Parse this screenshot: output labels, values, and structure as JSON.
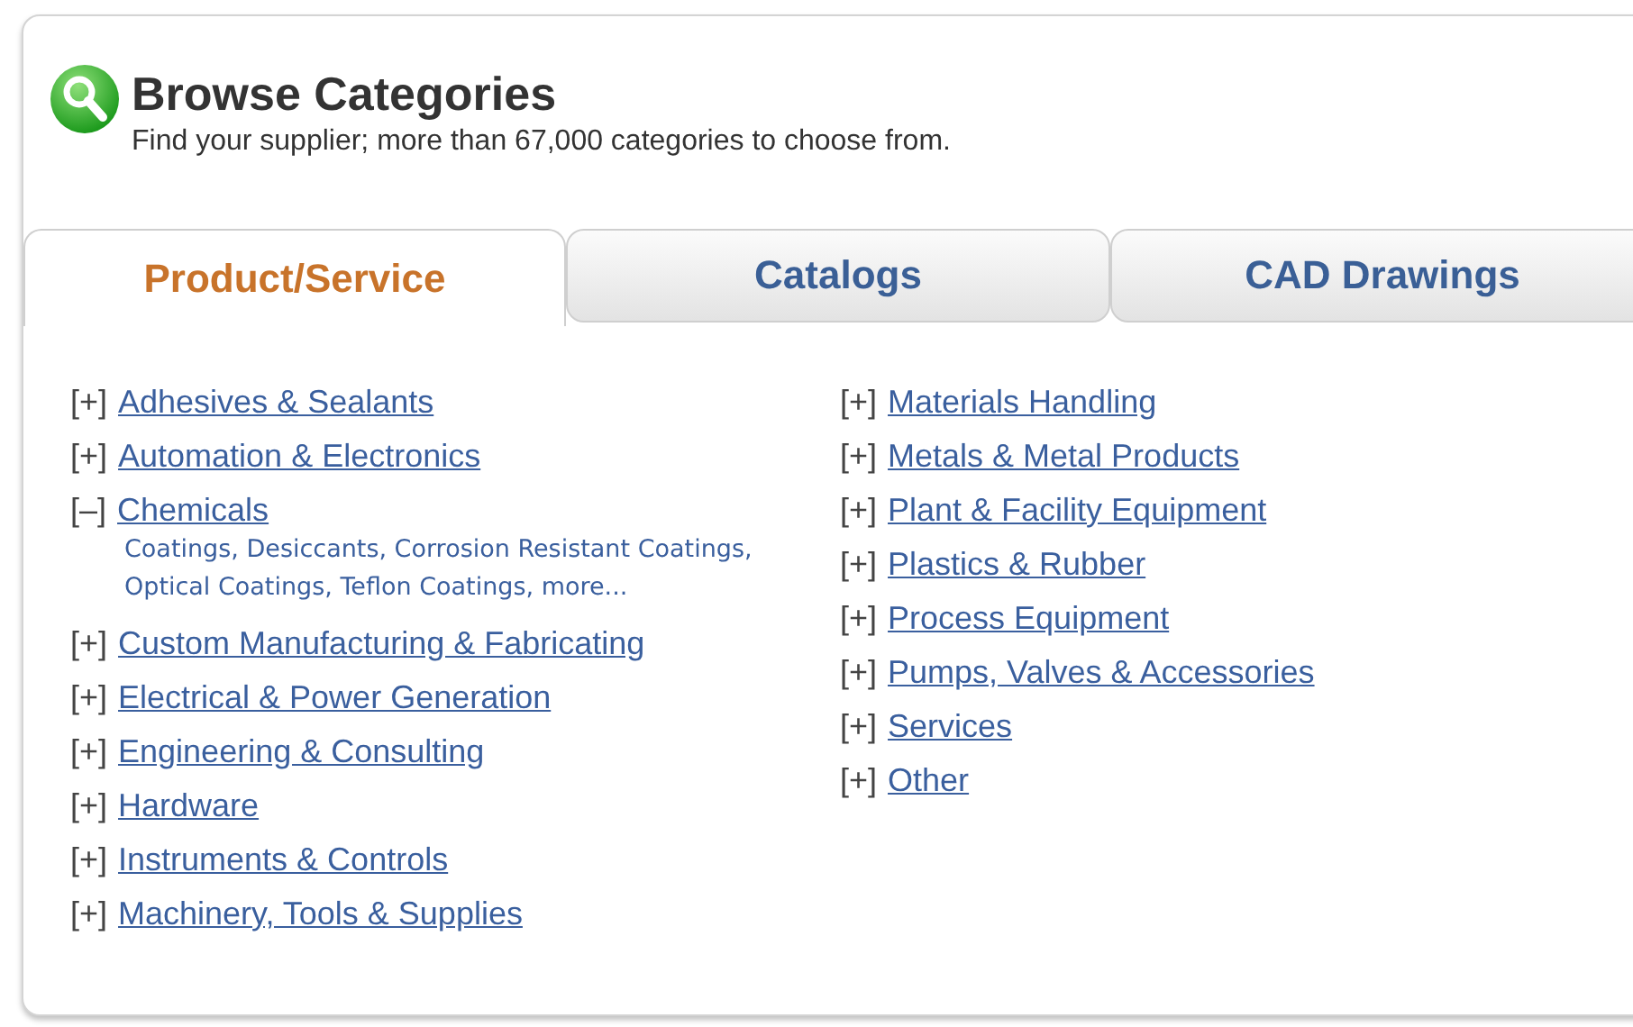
{
  "header": {
    "title": "Browse Categories",
    "subtitle": "Find your supplier; more than 67,000 categories to choose from."
  },
  "tabs": [
    {
      "label": "Product/Service",
      "selected": true
    },
    {
      "label": "Catalogs",
      "selected": false
    },
    {
      "label": "CAD Drawings",
      "selected": false
    }
  ],
  "columns": [
    [
      {
        "toggle": "[+]",
        "label": "Adhesives & Sealants"
      },
      {
        "toggle": "[+]",
        "label": "Automation & Electronics"
      },
      {
        "toggle": "[–]",
        "label": "Chemicals",
        "subcategories": "Coatings, Desiccants, Corrosion Resistant Coatings, Optical Coatings, Teflon Coatings, more..."
      },
      {
        "toggle": "[+]",
        "label": "Custom Manufacturing & Fabricating"
      },
      {
        "toggle": "[+]",
        "label": "Electrical & Power Generation"
      },
      {
        "toggle": "[+]",
        "label": "Engineering & Consulting"
      },
      {
        "toggle": "[+]",
        "label": "Hardware"
      },
      {
        "toggle": "[+]",
        "label": "Instruments & Controls"
      },
      {
        "toggle": "[+]",
        "label": "Machinery, Tools & Supplies"
      }
    ],
    [
      {
        "toggle": "[+]",
        "label": "Materials Handling"
      },
      {
        "toggle": "[+]",
        "label": "Metals & Metal Products"
      },
      {
        "toggle": "[+]",
        "label": "Plant & Facility Equipment"
      },
      {
        "toggle": "[+]",
        "label": "Plastics & Rubber"
      },
      {
        "toggle": "[+]",
        "label": "Process Equipment"
      },
      {
        "toggle": "[+]",
        "label": "Pumps, Valves & Accessories"
      },
      {
        "toggle": "[+]",
        "label": "Services"
      },
      {
        "toggle": "[+]",
        "label": "Other"
      }
    ]
  ]
}
